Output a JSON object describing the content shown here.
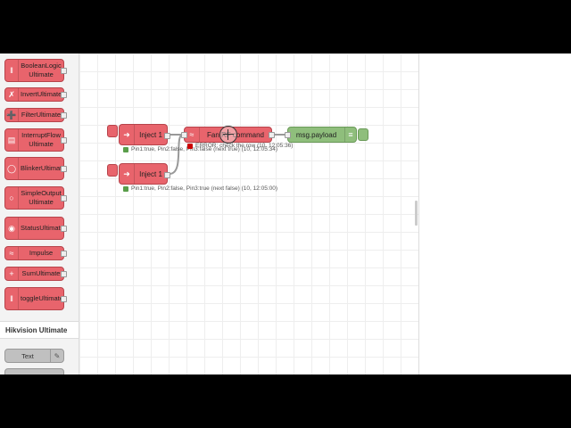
{
  "palette": {
    "nodes": [
      {
        "label": "BooleanLogic Ultimate",
        "icon": "boolean-icon"
      },
      {
        "label": "InvertUltimate",
        "icon": "shuffle-icon"
      },
      {
        "label": "FilterUltimate",
        "icon": "arrows-icon"
      },
      {
        "label": "InterruptFlow Ultimate",
        "icon": "document-icon"
      },
      {
        "label": "BlinkerUltimate",
        "icon": "bulb-icon"
      },
      {
        "label": "SimpleOutput Ultimate",
        "icon": "circle-icon"
      },
      {
        "label": "StatusUltimate",
        "icon": "eye-icon"
      },
      {
        "label": "Impulse",
        "icon": "wifi-icon"
      },
      {
        "label": "SumUltimate",
        "icon": "plus-icon"
      },
      {
        "label": "toggleUltimate",
        "icon": "toggle-icon"
      }
    ],
    "category": "Hikvision Ultimate",
    "hik_nodes": [
      {
        "label": "Text",
        "icon": "edit-icon"
      }
    ]
  },
  "flow": {
    "inject1_label": "Inject 1",
    "inject2_label": "Inject 1",
    "inject1_status": "Pin1:true, Pin2:false, Pin3:false (next true) (10, 12:05:34)",
    "inject2_status": "Pin1:true, Pin2:false, Pin3:true (next false) (10, 12:05:00)",
    "fan_label": "Fan RF command",
    "fan_status": "ERROR: check the row (10, 12:05:36)",
    "debug_label": "msg.payload"
  },
  "colors": {
    "node_red": "#e8646c",
    "debug_green": "#8fbe7c",
    "status_green": "#5a9e4a",
    "status_red": "#cc0000"
  }
}
